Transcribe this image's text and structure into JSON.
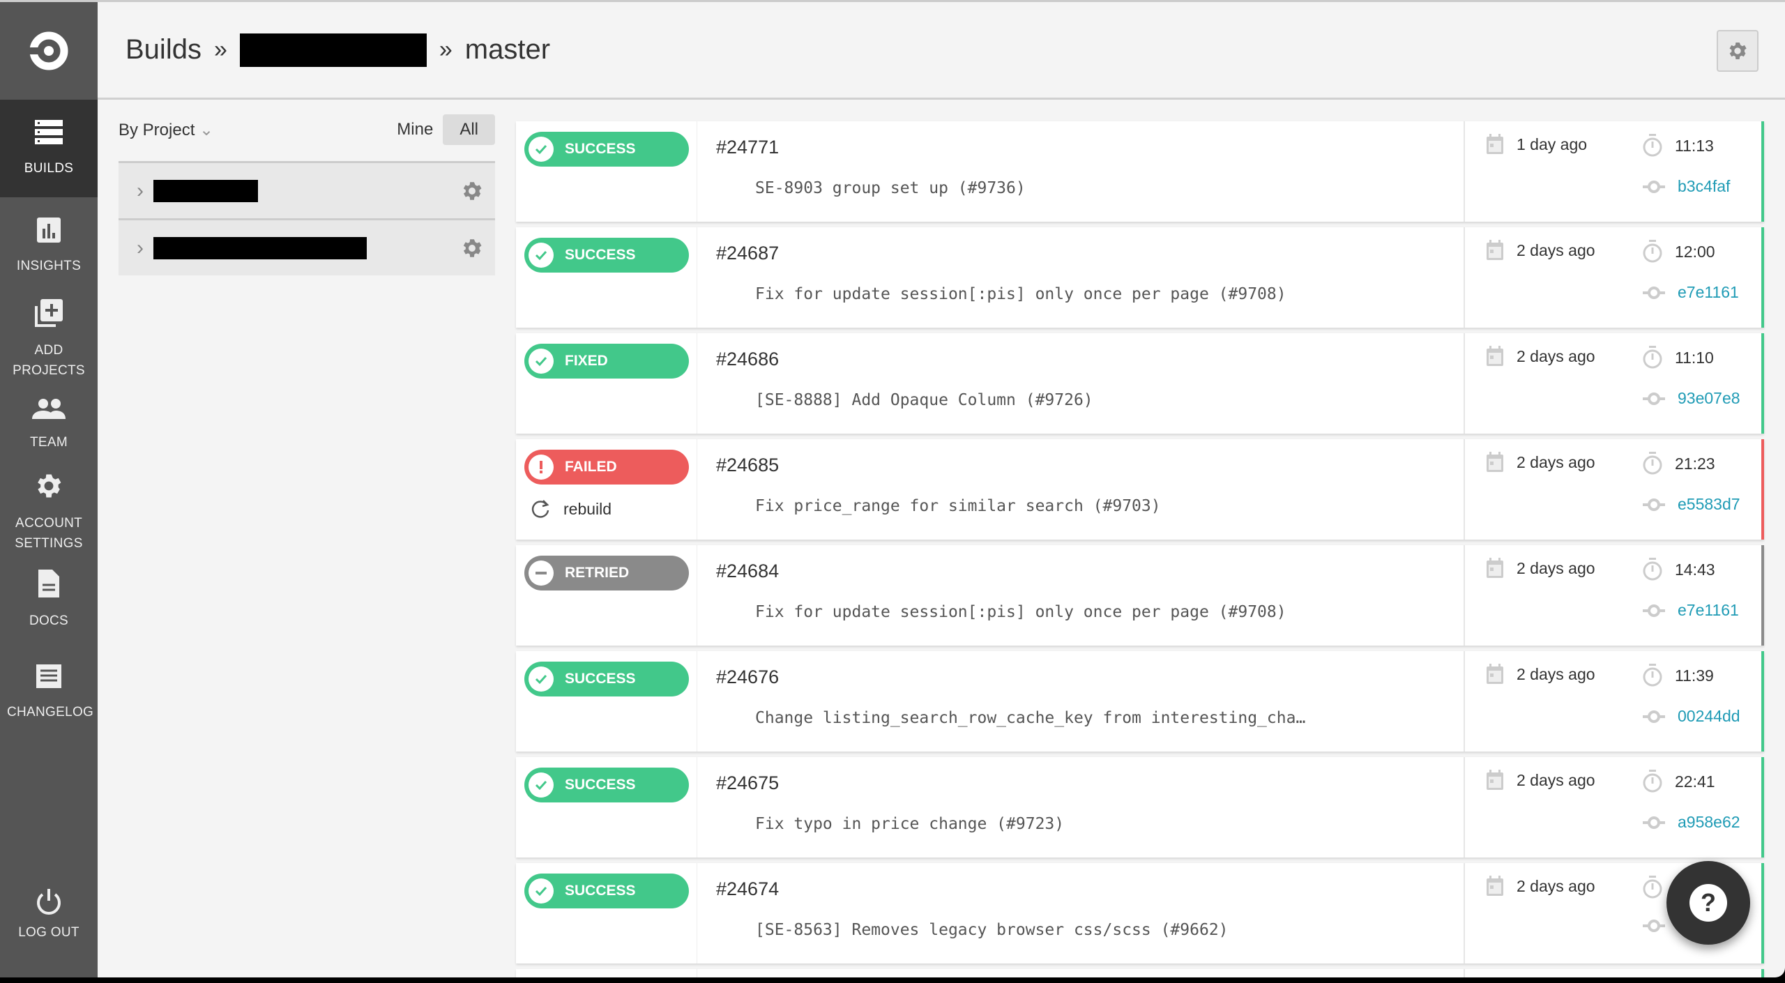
{
  "sidebar": {
    "items": [
      {
        "label": "BUILDS",
        "icon": "builds-icon",
        "active": true
      },
      {
        "label": "INSIGHTS",
        "icon": "insights-icon"
      },
      {
        "label": "ADD PROJECTS",
        "icon": "add-projects-icon"
      },
      {
        "label": "TEAM",
        "icon": "team-icon"
      },
      {
        "label": "ACCOUNT SETTINGS",
        "icon": "gear-icon"
      },
      {
        "label": "DOCS",
        "icon": "docs-icon"
      },
      {
        "label": "CHANGELOG",
        "icon": "changelog-icon"
      }
    ],
    "logout": "LOG OUT"
  },
  "header": {
    "title": "Builds",
    "sep": "»",
    "branch": "master"
  },
  "filter": {
    "group": "By Project",
    "mine": "Mine",
    "all": "All"
  },
  "colors": {
    "success": "#42c88a",
    "failed": "#ed5c5c",
    "retried": "#8a8a8a",
    "link": "#1f9bb5"
  },
  "builds": [
    {
      "status": "SUCCESS",
      "kind": "success",
      "num": "#24771",
      "msg": "SE-8903 group set up (#9736)",
      "date": "1 day ago",
      "time": "11:13",
      "hash": "b3c4faf"
    },
    {
      "status": "SUCCESS",
      "kind": "success",
      "num": "#24687",
      "msg": "Fix for update session[:pis] only once per page (#9708)",
      "date": "2 days ago",
      "time": "12:00",
      "hash": "e7e1161"
    },
    {
      "status": "FIXED",
      "kind": "success",
      "num": "#24686",
      "msg": "[SE-8888] Add Opaque Column (#9726)",
      "date": "2 days ago",
      "time": "11:10",
      "hash": "93e07e8"
    },
    {
      "status": "FAILED",
      "kind": "failed",
      "num": "#24685",
      "msg": "Fix price_range for similar search (#9703)",
      "date": "2 days ago",
      "time": "21:23",
      "hash": "e5583d7",
      "action": "rebuild"
    },
    {
      "status": "RETRIED",
      "kind": "retried",
      "num": "#24684",
      "msg": "Fix for update session[:pis] only once per page (#9708)",
      "date": "2 days ago",
      "time": "14:43",
      "hash": "e7e1161"
    },
    {
      "status": "SUCCESS",
      "kind": "success",
      "num": "#24676",
      "msg": "Change listing_search_row_cache_key from interesting_cha…",
      "date": "2 days ago",
      "time": "11:39",
      "hash": "00244dd"
    },
    {
      "status": "SUCCESS",
      "kind": "success",
      "num": "#24675",
      "msg": "Fix typo in price change (#9723)",
      "date": "2 days ago",
      "time": "22:41",
      "hash": "a958e62"
    },
    {
      "status": "SUCCESS",
      "kind": "success",
      "num": "#24674",
      "msg": "[SE-8563] Removes legacy browser css/scss (#9662)",
      "date": "2 days ago"
    }
  ]
}
